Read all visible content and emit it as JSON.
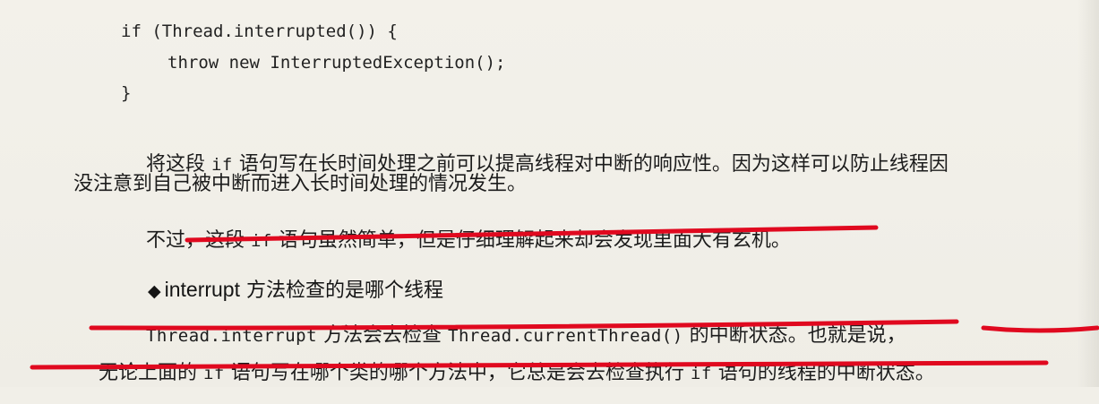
{
  "code": {
    "line1": "if (Thread.interrupted()) {",
    "line2": "throw new InterruptedException();",
    "line3": "}"
  },
  "paragraph1": {
    "l1_a": "将这段 ",
    "l1_code": "if",
    "l1_b": " 语句写在长时间处理之前可以提高线程对中断的响应性。因为这样可以防止线程因",
    "l2": "没注意到自己被中断而进入长时间处理的情况发生。"
  },
  "paragraph2": {
    "a": "不过，这段 ",
    "code": "if",
    "b": " 语句虽然简单，但是仔细理解起来却会发现里面大有玄机。"
  },
  "heading": {
    "diamond": "◆",
    "method": "interrupt",
    "rest": " 方法检查的是哪个线程"
  },
  "paragraph3": {
    "l1_code1": "Thread.interrupt",
    "l1_a": " 方法会去检查 ",
    "l1_code2": "Thread.currentThread()",
    "l1_b": " 的中断状态。也就是说，",
    "l2_a": "无论上面的 ",
    "l2_code1": "if",
    "l2_b": " 语句写在哪个类的哪个方法中，它总是会去检查执行 ",
    "l2_code2": "if",
    "l2_c": " 语句的线程的中断状态。"
  },
  "annotations": {
    "underline_color": "#e0091f"
  }
}
